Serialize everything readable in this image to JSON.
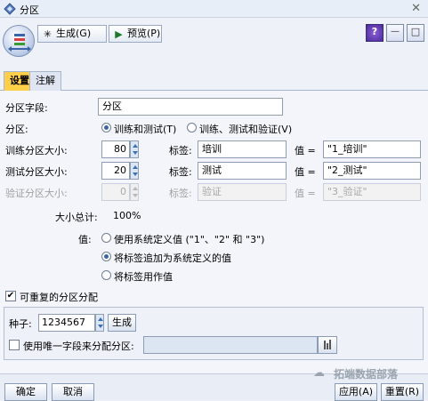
{
  "window": {
    "title": "分区",
    "close_glyph": "✕"
  },
  "toolbar": {
    "generate_label": "生成(G)",
    "preview_label": "预览(P)",
    "help_glyph": "?",
    "minimize_glyph": "—",
    "maximize_glyph": "□"
  },
  "tabs": [
    {
      "label": "设置",
      "active": true
    },
    {
      "label": "注解",
      "active": false
    }
  ],
  "settings": {
    "partition_field_label": "分区字段:",
    "partition_field_value": "分区",
    "partition_label": "分区:",
    "partition_options": [
      {
        "label": "训练和测试(T)",
        "selected": true
      },
      {
        "label": "训练、测试和验证(V)",
        "selected": false
      }
    ],
    "rows": [
      {
        "label": "训练分区大小:",
        "size": "80",
        "tag_label": "标签:",
        "tag_value": "培训",
        "value_label": "值 =",
        "value": "\"1_培训\"",
        "enabled": true
      },
      {
        "label": "测试分区大小:",
        "size": "20",
        "tag_label": "标签:",
        "tag_value": "测试",
        "value_label": "值 =",
        "value": "\"2_测试\"",
        "enabled": true
      },
      {
        "label": "验证分区大小:",
        "size": "0",
        "tag_label": "标签:",
        "tag_value": "验证",
        "value_label": "值 =",
        "value": "\"3_验证\"",
        "enabled": false
      }
    ],
    "total_label": "大小总计:",
    "total_value": "100%",
    "values_label": "值:",
    "value_options": [
      {
        "label": "使用系统定义值 (\"1\"、\"2\" 和 \"3\")",
        "selected": false
      },
      {
        "label": "将标签追加为系统定义的值",
        "selected": true
      },
      {
        "label": "将标签用作值",
        "selected": false
      }
    ],
    "repeatable_label": "可重复的分区分配",
    "repeatable_checked": true,
    "seed_label": "种子:",
    "seed_value": "1234567",
    "seed_generate_label": "生成",
    "unique_field_label": "使用唯一字段来分配分区:",
    "unique_field_checked": false,
    "unique_field_value": ""
  },
  "footer": {
    "ok_label": "确定",
    "cancel_label": "取消",
    "apply_label": "应用(A)",
    "reset_label": "重置(R)"
  },
  "watermark": {
    "text": "拓端数据部落"
  },
  "colors": {
    "active_tab": "#ffcf4a",
    "radio_dot": "#3a63a8",
    "spin_arrow": "#3b6fb3"
  }
}
